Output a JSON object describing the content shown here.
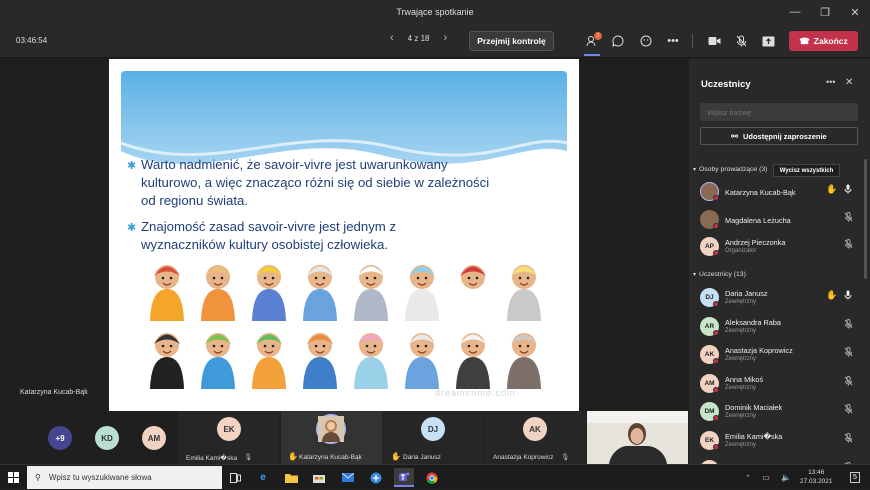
{
  "window": {
    "title": "Trwające spotkanie"
  },
  "toolbar": {
    "timer": "03:46:54",
    "page": "4 z 18",
    "take_control": "Przejmij kontrolę",
    "participants_badge": "2",
    "end_call": "Zakończ",
    "accent": "#c4314b"
  },
  "slide": {
    "bullets": [
      "Warto nadmienić, że savoir-vivre jest uwarunkowany kulturowo, a więc znacząco różni się od siebie w zależności od regionu świata.",
      "Znajomość zasad savoir-vivre jest jednym z wyznaczników kultury osobistej człowieka."
    ],
    "watermark": "dreamstime.com",
    "presenter_label": "Katarzyna Kucab-Bąk"
  },
  "strip": {
    "overflow": "+9",
    "avatars": [
      "KD",
      "AM"
    ],
    "tiles": [
      {
        "initials": "EK",
        "name": "Emilia Kami�ska"
      },
      {
        "initials": "",
        "name": "Katarzyna Kucab-Bąk"
      },
      {
        "initials": "DJ",
        "name": "Daria Janusz"
      },
      {
        "initials": "AK",
        "name": "Anastazja Koprowicz"
      }
    ]
  },
  "panel": {
    "title": "Uczestnicy",
    "search_placeholder": "Wpisz nazwę",
    "share_label": "Udostępnij zaproszenie",
    "presenters_header": "Osoby prowadzące (3)",
    "mute_all": "Wycisz wszystkich",
    "attendees_header": "Uczestnicy (13)",
    "presenters": [
      {
        "initials": "KK",
        "name": "Katarzyna Kucab-Bąk",
        "role": "",
        "hand": true,
        "mic": "on"
      },
      {
        "initials": "ML",
        "name": "Magdalena Leżucha",
        "role": "",
        "hand": false,
        "mic": "off"
      },
      {
        "initials": "AP",
        "name": "Andrzej Pieczonka",
        "role": "Organizator",
        "hand": false,
        "mic": "off"
      }
    ],
    "attendees": [
      {
        "initials": "DJ",
        "name": "Daria Janusz",
        "role": "Zewnętrzny",
        "hand": true,
        "mic": "on"
      },
      {
        "initials": "AR",
        "name": "Aleksandra Raba",
        "role": "Zewnętrzny",
        "hand": false,
        "mic": "off"
      },
      {
        "initials": "AK",
        "name": "Anastazja Koprowicz",
        "role": "Zewnętrzny",
        "hand": false,
        "mic": "off"
      },
      {
        "initials": "AM",
        "name": "Anna Mikoś",
        "role": "Zewnętrzny",
        "hand": false,
        "mic": "off"
      },
      {
        "initials": "DM",
        "name": "Dominik Maciałek",
        "role": "Zewnętrzny",
        "hand": false,
        "mic": "off"
      },
      {
        "initials": "EK",
        "name": "Emilia Kami�ska",
        "role": "Zewnętrzny",
        "hand": false,
        "mic": "off"
      },
      {
        "initials": "FK",
        "name": "Filip Krzanowski",
        "role": "",
        "hand": false,
        "mic": "off"
      }
    ]
  },
  "taskbar": {
    "search_placeholder": "Wpisz tu wyszukiwane słowa",
    "time": "13:46",
    "date": "27.03.2021",
    "notifications": "5"
  }
}
